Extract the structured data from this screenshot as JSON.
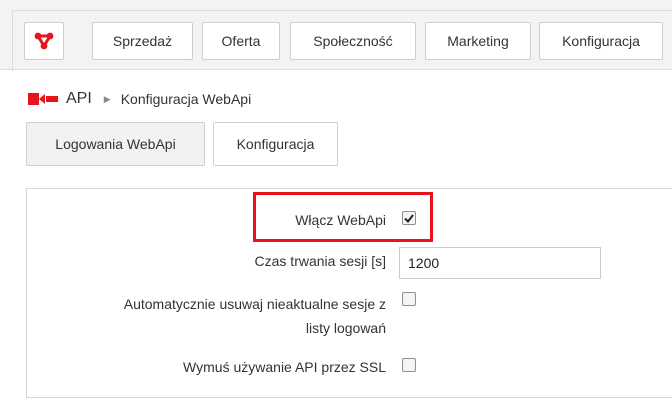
{
  "topnav": {
    "logo_icon": "share-nodes-icon",
    "brand_color": "#e8141c",
    "items": [
      {
        "label": "Sprzedaż"
      },
      {
        "label": "Oferta"
      },
      {
        "label": "Społeczność"
      },
      {
        "label": "Marketing"
      },
      {
        "label": "Konfiguracja"
      }
    ]
  },
  "breadcrumb": {
    "icon": "api-logo-icon",
    "root": "API",
    "separator": "▶",
    "current": "Konfiguracja WebApi"
  },
  "tabs": [
    {
      "label": "Logowania WebApi",
      "active": false
    },
    {
      "label": "Konfiguracja",
      "active": true
    }
  ],
  "form": {
    "enable_webapi": {
      "label": "Włącz WebApi",
      "checked": true,
      "highlight_color": "#e8141c"
    },
    "session_duration": {
      "label": "Czas trwania sesji [s]",
      "value": "1200"
    },
    "auto_remove_sessions": {
      "label_line1": "Automatycznie usuwaj nieaktualne sesje z",
      "label_line2": "listy logowań",
      "checked": false
    },
    "force_ssl": {
      "label": "Wymuś używanie API przez SSL",
      "checked": false
    }
  }
}
